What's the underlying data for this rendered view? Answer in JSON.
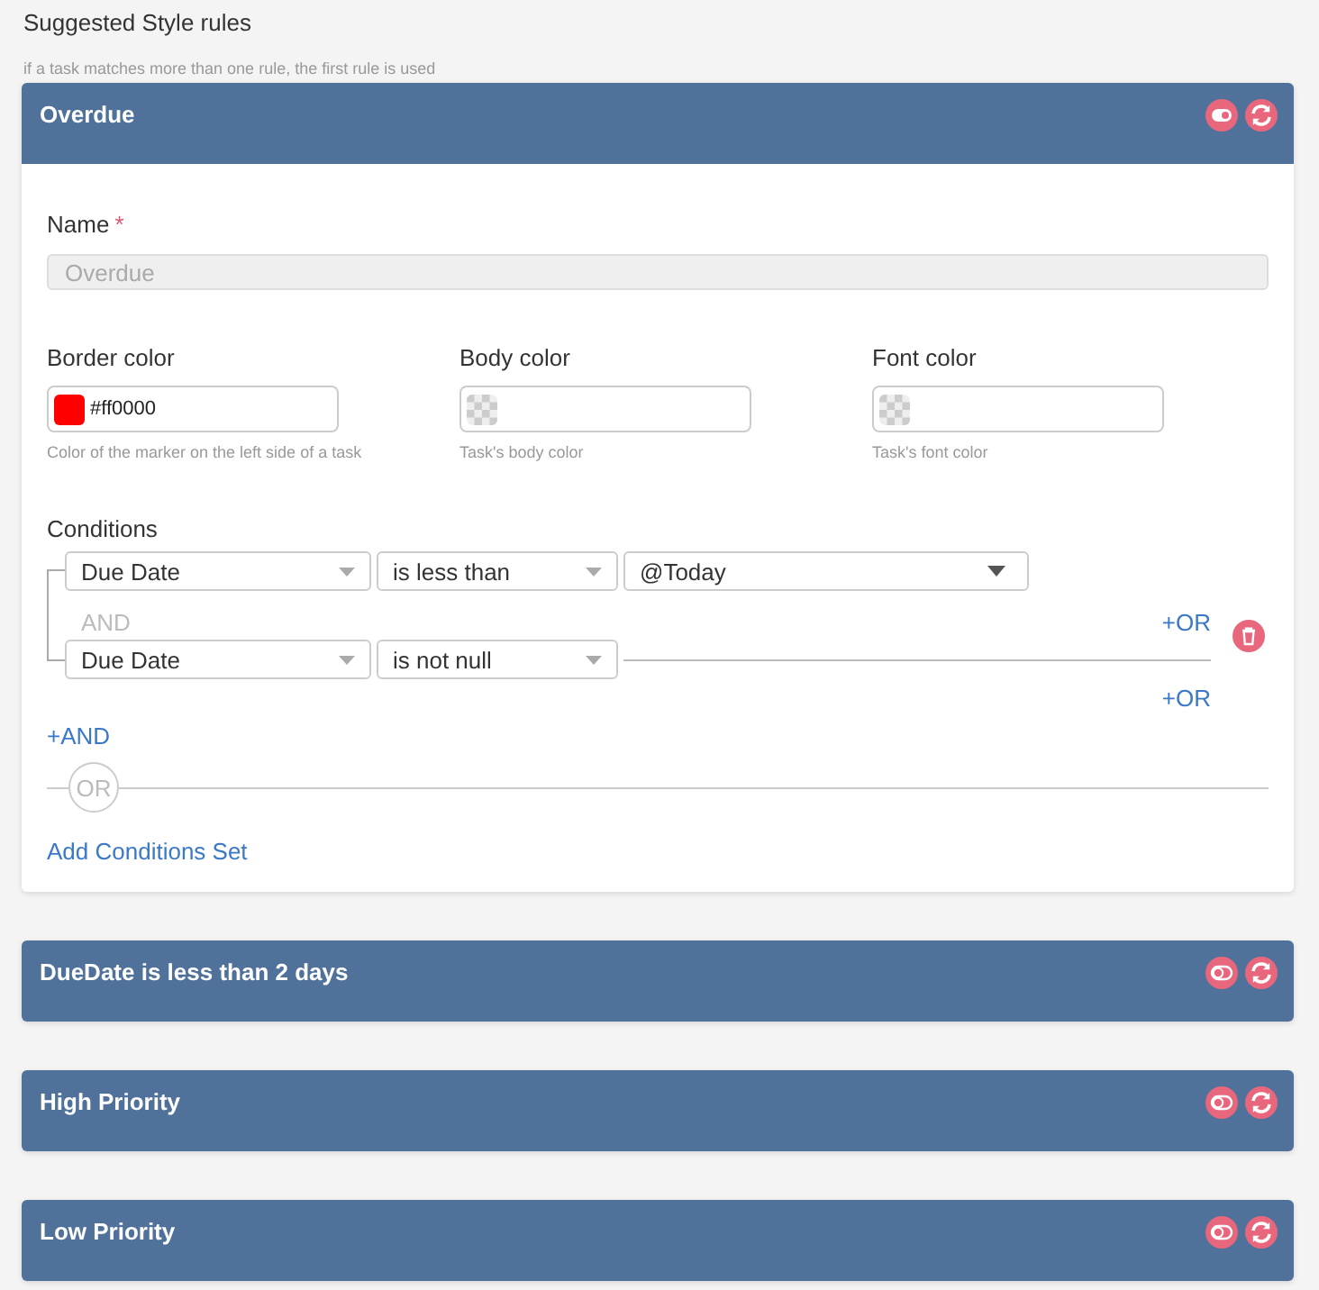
{
  "title": "Suggested Style rules",
  "subtitle": "if a task matches more than one rule, the first rule is used",
  "rules": [
    {
      "title": "Overdue",
      "enabled": true,
      "expanded": true,
      "form": {
        "name_label": "Name",
        "required_mark": "*",
        "name_field": {
          "value": "Overdue",
          "disabled": true
        },
        "colors": [
          {
            "label": "Border color",
            "value": "#ff0000",
            "color": "#ff0000",
            "hint": "Color of the marker on the left side of a task"
          },
          {
            "label": "Body color",
            "hint": "Task's body color"
          },
          {
            "label": "Font color",
            "hint": "Task's font color"
          }
        ],
        "conditions_label": "Conditions",
        "conditions": [
          {
            "field": "Due Date",
            "operator": "is less than",
            "value": "@Today"
          },
          {
            "field": "Due Date",
            "operator": "is not null"
          }
        ],
        "and_label": "AND",
        "add_or": [
          "+OR",
          "+OR"
        ],
        "add_and": "+AND",
        "or_label": "OR",
        "add_set": "Add Conditions Set"
      }
    },
    {
      "title": "DueDate is less than 2 days",
      "enabled": false,
      "expanded": false
    },
    {
      "title": "High Priority",
      "enabled": false,
      "expanded": false
    },
    {
      "title": "Low Priority",
      "enabled": false,
      "expanded": false
    }
  ]
}
